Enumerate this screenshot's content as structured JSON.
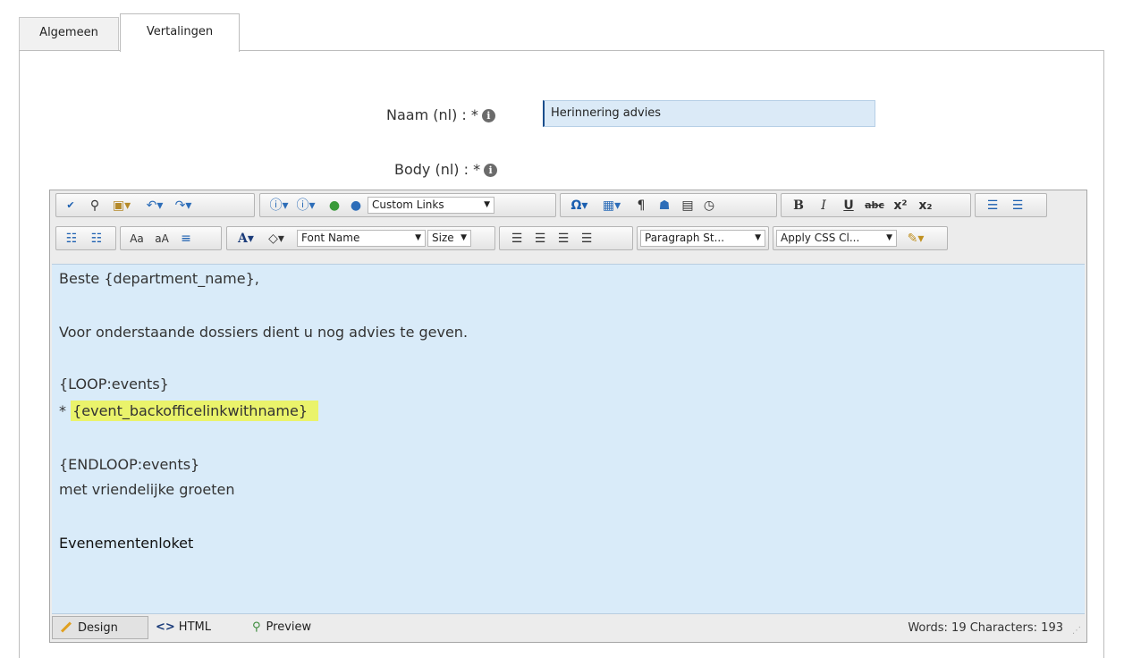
{
  "tabs": [
    {
      "label": "Algemeen",
      "active": false
    },
    {
      "label": "Vertalingen",
      "active": true
    }
  ],
  "form": {
    "name_label": "Naam (nl) : *",
    "name_value": "Herinnering advies",
    "body_label": "Body (nl) : *"
  },
  "editor": {
    "toolbar1": {
      "custom_links": "Custom Links"
    },
    "toolbar2": {
      "font_name": "Font Name",
      "size": "Size",
      "paragraph_style": "Paragraph St...",
      "apply_css": "Apply CSS Cl..."
    },
    "content": {
      "line1": "Beste {department_name},",
      "line2": "Voor onderstaande dossiers dient u nog advies te geven.",
      "line3": "{LOOP:events}",
      "line4_prefix": "* ",
      "line4_highlight": "{event_backofficelinkwithname}",
      "line5": "{ENDLOOP:events}",
      "line6": "met vriendelijke groeten",
      "line7": "Evenementenloket"
    },
    "modes": {
      "design": "Design",
      "html": "HTML",
      "preview": "Preview"
    },
    "counts": "Words: 19  Characters: 193",
    "highlight_color": "#eaf36b",
    "content_bg": "#d9ebf9"
  }
}
